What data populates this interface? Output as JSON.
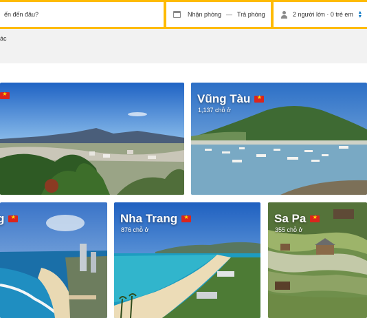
{
  "search": {
    "destination_placeholder": "ến đến đâu?",
    "checkin_label": "Nhận phòng",
    "date_separator": "—",
    "checkout_label": "Trả phòng",
    "guests_summary": "2 người lớn · 0 trẻ em"
  },
  "filter_strip": {
    "text": "ác"
  },
  "destinations": [
    {
      "name": "",
      "count": "",
      "country_flag": "vietnam-flag-icon"
    },
    {
      "name": "Vũng Tàu",
      "count": "1,137 chỗ ở",
      "country_flag": "vietnam-flag-icon"
    },
    {
      "name": "g",
      "count": "",
      "country_flag": "vietnam-flag-icon"
    },
    {
      "name": "Nha Trang",
      "count": "876 chỗ ở",
      "country_flag": "vietnam-flag-icon"
    },
    {
      "name": "Sa Pa",
      "count": "355 chỗ ở",
      "country_flag": "vietnam-flag-icon"
    }
  ],
  "colors": {
    "search_border": "#febb02",
    "flag_red": "#da251d",
    "flag_star": "#ffde00",
    "accent_blue": "#0071c2"
  }
}
